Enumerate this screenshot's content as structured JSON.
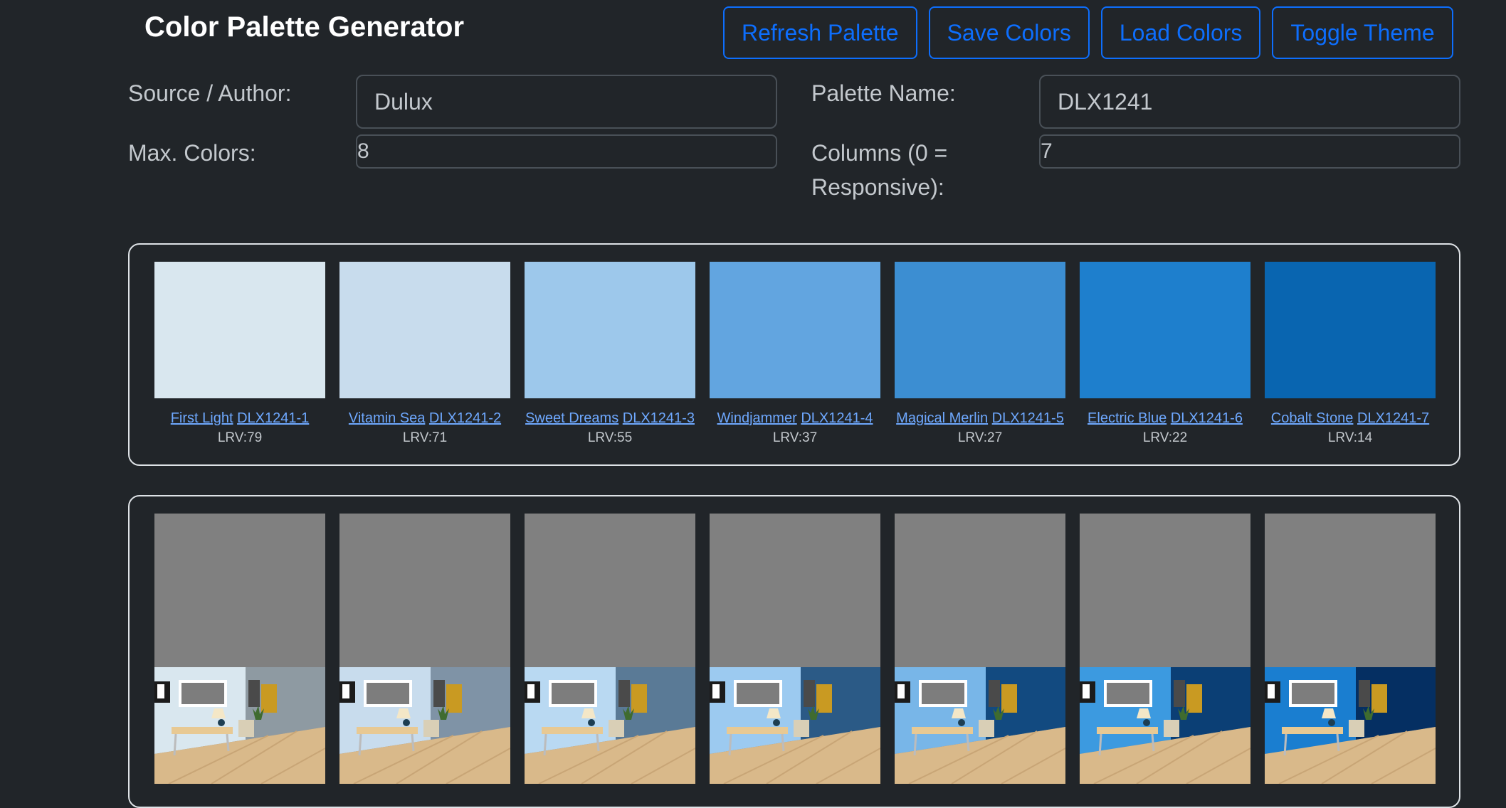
{
  "header": {
    "title": "Color Palette Generator",
    "buttons": {
      "refresh": "Refresh Palette",
      "save": "Save Colors",
      "load": "Load Colors",
      "theme": "Toggle Theme"
    }
  },
  "form": {
    "source_label": "Source / Author:",
    "source_value": "Dulux",
    "palette_name_label": "Palette Name:",
    "palette_name_value": "DLX1241",
    "max_colors_label": "Max. Colors:",
    "max_colors_value": "8",
    "columns_label_line1": "Columns (0 =",
    "columns_label_line2": "Responsive):",
    "columns_value": "7"
  },
  "palette": {
    "swatches": [
      {
        "name": "First Light",
        "code": "DLX1241-1",
        "lrv": "LRV:79",
        "color": "#d9e7ef",
        "wall": "#d9e7ef",
        "side": "#8e9aa2"
      },
      {
        "name": "Vitamin Sea",
        "code": "DLX1241-2",
        "lrv": "LRV:71",
        "color": "#c8dced",
        "wall": "#c8dced",
        "side": "#7f93a6"
      },
      {
        "name": "Sweet Dreams",
        "code": "DLX1241-3",
        "lrv": "LRV:55",
        "color": "#9dc8eb",
        "wall": "#b9d9f2",
        "side": "#5a7a96"
      },
      {
        "name": "Windjammer",
        "code": "DLX1241-4",
        "lrv": "LRV:37",
        "color": "#62a5e0",
        "wall": "#9ccaf0",
        "side": "#2b5a86"
      },
      {
        "name": "Magical Merlin",
        "code": "DLX1241-5",
        "lrv": "LRV:27",
        "color": "#3c8ed2",
        "wall": "#78b6e8",
        "side": "#124a80"
      },
      {
        "name": "Electric Blue",
        "code": "DLX1241-6",
        "lrv": "LRV:22",
        "color": "#1e7fcd",
        "wall": "#3c9ae0",
        "side": "#0b3f75"
      },
      {
        "name": "Cobalt Stone",
        "code": "DLX1241-7",
        "lrv": "LRV:14",
        "color": "#0965b0",
        "wall": "#1a7ed0",
        "side": "#052f62"
      }
    ]
  }
}
